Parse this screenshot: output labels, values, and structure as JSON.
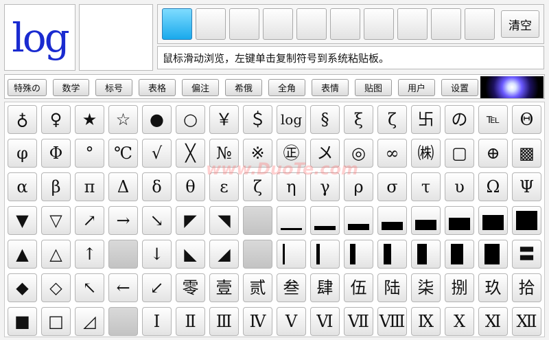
{
  "preview": {
    "symbol": "log"
  },
  "toolbar": {
    "clear_label": "清空"
  },
  "hint": "鼠标滑动浏览，左键单击复制符号到系统粘贴板。",
  "tabs": [
    "特殊の",
    "数学",
    "标号",
    "表格",
    "偏注",
    "希俄",
    "全角",
    "表情",
    "贴图",
    "用户",
    "设置"
  ],
  "watermark": "www.DuoTe.com",
  "grid": {
    "rows": [
      [
        "♁",
        "♀",
        "★",
        "☆",
        "●",
        "○",
        "￥",
        "＄",
        "log",
        "§",
        "ξ",
        "ζ",
        "卐",
        "の",
        "℡",
        "Θ"
      ],
      [
        "φ",
        "Φ",
        "°",
        "℃",
        "√",
        "╳",
        "№",
        "※",
        "㊣",
        "〤",
        "◎",
        "∞",
        "㈱",
        "▢",
        "⊕",
        "▩"
      ],
      [
        "α",
        "β",
        "π",
        "Δ",
        "δ",
        "θ",
        "ε",
        "ζ",
        "η",
        "γ",
        "ρ",
        "σ",
        "τ",
        "υ",
        "Ω",
        "Ψ"
      ],
      [
        "▼",
        "▽",
        "↗",
        "→",
        "↘",
        "◤",
        "◥",
        "",
        "▁",
        "▂",
        "▃",
        "▄",
        "▅",
        "▆",
        "▇",
        "█"
      ],
      [
        "▲",
        "△",
        "↑",
        "",
        "↓",
        "◣",
        "◢",
        "",
        "▏",
        "▎",
        "▍",
        "▌",
        "▋",
        "▊",
        "▉",
        "〓"
      ],
      [
        "◆",
        "◇",
        "↖",
        "←",
        "↙",
        "零",
        "壹",
        "贰",
        "叁",
        "肆",
        "伍",
        "陆",
        "柒",
        "捌",
        "玖",
        "拾"
      ],
      [
        "■",
        "□",
        "◿",
        "",
        "Ⅰ",
        "Ⅱ",
        "Ⅲ",
        "Ⅳ",
        "Ⅴ",
        "Ⅵ",
        "Ⅶ",
        "Ⅷ",
        "Ⅸ",
        "Ⅹ",
        "Ⅺ",
        "Ⅻ"
      ]
    ]
  }
}
